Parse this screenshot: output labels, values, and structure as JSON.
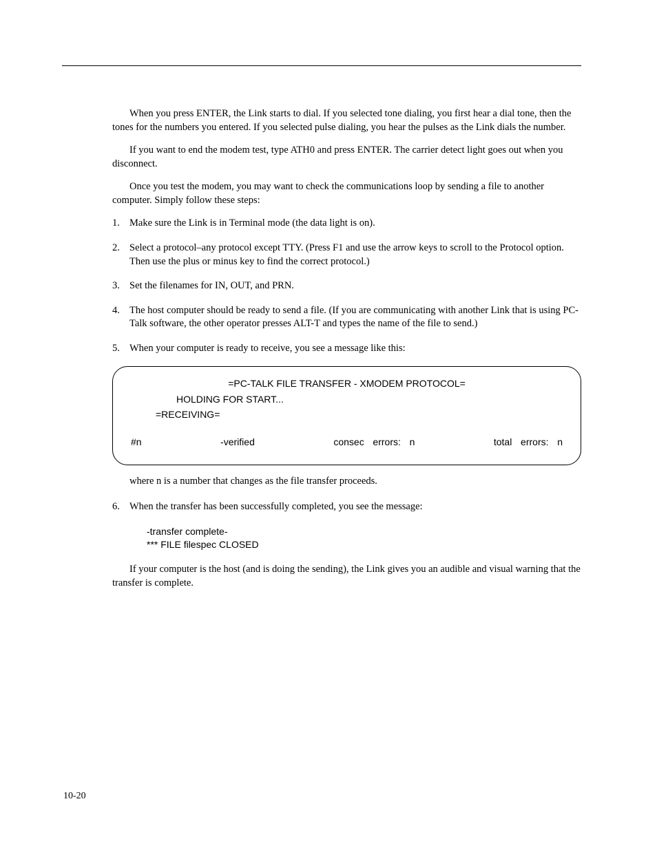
{
  "para1_a": "When you press ",
  "para1_enter": "ENTER",
  "para1_b": ", the Link starts to dial. If you selected tone dialing, you first hear a dial tone, then the tones for the numbers you entered. If you selected pulse dialing, you hear the pulses as the Link dials the number.",
  "para2": "If you want to end the modem test, type ATH0 and press ",
  "para2_enter": "ENTER",
  "para2_b": ". The carrier detect light goes out when you disconnect.",
  "para3": "Once you test the modem, you may want to check the communications loop by sending a file to another computer. Simply follow these steps:",
  "step1_num": "1.",
  "step1_text": "Make sure the Link is in Terminal mode (the data light is on).",
  "step2_num": "2.",
  "step2_text_a": "Select a protocol–any protocol except TTY. (Press ",
  "step2_f1": "F1",
  "step2_text_b": " and use the arrow keys to scroll to the Protocol option. Then use the plus or minus key to find the correct protocol.)",
  "step3_num": "3.",
  "step3_text": "Set the filenames for IN, OUT, and PRN.",
  "step4_num": "4.",
  "step4_text_a": "The host computer should be ready to send a file.  (If you are communicating with another Link that is using PC-Talk software, the other operator presses ",
  "step4_alt": "ALT",
  "step4_dash": "-",
  "step4_t": "T",
  "step4_text_b": " and types the name of the file to send.)",
  "step5_num": "5.",
  "step5_text": "When your computer is ready to receive, you see a message like this:",
  "box_line1": "=PC-TALK FILE TRANSFER - XMODEM PROTOCOL=",
  "box_line2": "HOLDING FOR START...",
  "box_line3": "=RECEIVING=",
  "box_fields": "#n         -verified         consec errors: n         total errors: n",
  "para4_a": "where ",
  "para4_n": "n",
  "para4_b": " is a number that changes as the file transfer proceeds.",
  "step6_num": "6.",
  "step6_text": "When the transfer has been successfully completed, you see the message:",
  "msg1": "-transfer complete-",
  "msg2": "*** FILE filespec CLOSED",
  "para5": "If your computer is the host (and is doing the sending), the Link gives you an audible and visual warning that the transfer is complete.",
  "page_number": "10-20"
}
